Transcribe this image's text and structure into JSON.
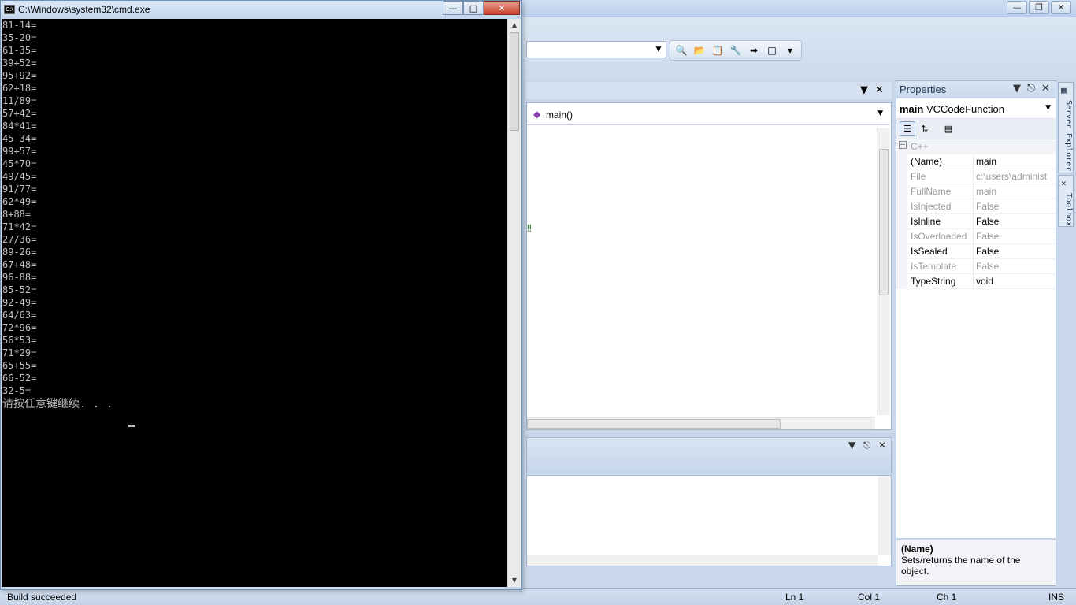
{
  "ide": {
    "member_combo": "main()",
    "properties": {
      "title": "Properties",
      "object_name": "main",
      "object_type": "VCCodeFunction",
      "category": "C++",
      "rows": [
        {
          "key": "(Name)",
          "value": "main",
          "readonly": false
        },
        {
          "key": "File",
          "value": "c:\\users\\administ",
          "readonly": true
        },
        {
          "key": "FullName",
          "value": "main",
          "readonly": true
        },
        {
          "key": "IsInjected",
          "value": "False",
          "readonly": true
        },
        {
          "key": "IsInline",
          "value": "False",
          "readonly": false
        },
        {
          "key": "IsOverloaded",
          "value": "False",
          "readonly": true
        },
        {
          "key": "IsSealed",
          "value": "False",
          "readonly": false
        },
        {
          "key": "IsTemplate",
          "value": "False",
          "readonly": true
        },
        {
          "key": "TypeString",
          "value": "void",
          "readonly": false
        }
      ],
      "desc_title": "(Name)",
      "desc_text": "Sets/returns the name of the object."
    },
    "side_tabs": [
      "Server Explorer",
      "Toolbox"
    ],
    "status": {
      "message": "Build succeeded",
      "ln": "Ln 1",
      "col": "Col 1",
      "ch": "Ch 1",
      "mode": "INS"
    }
  },
  "cmd": {
    "title": "C:\\Windows\\system32\\cmd.exe",
    "lines": [
      "81-14=",
      "35-20=",
      "61-35=",
      "39+52=",
      "95+92=",
      "62+18=",
      "11/89=",
      "57+42=",
      "84*41=",
      "45-34=",
      "99+57=",
      "45*70=",
      "49/45=",
      "91/77=",
      "62*49=",
      "8+88=",
      "71*42=",
      "27/36=",
      "89-26=",
      "67+48=",
      "96-88=",
      "85-52=",
      "92-49=",
      "64/63=",
      "72*96=",
      "56*53=",
      "71*29=",
      "65+55=",
      "66-52=",
      "32-5="
    ],
    "prompt": "请按任意键继续. . . "
  }
}
